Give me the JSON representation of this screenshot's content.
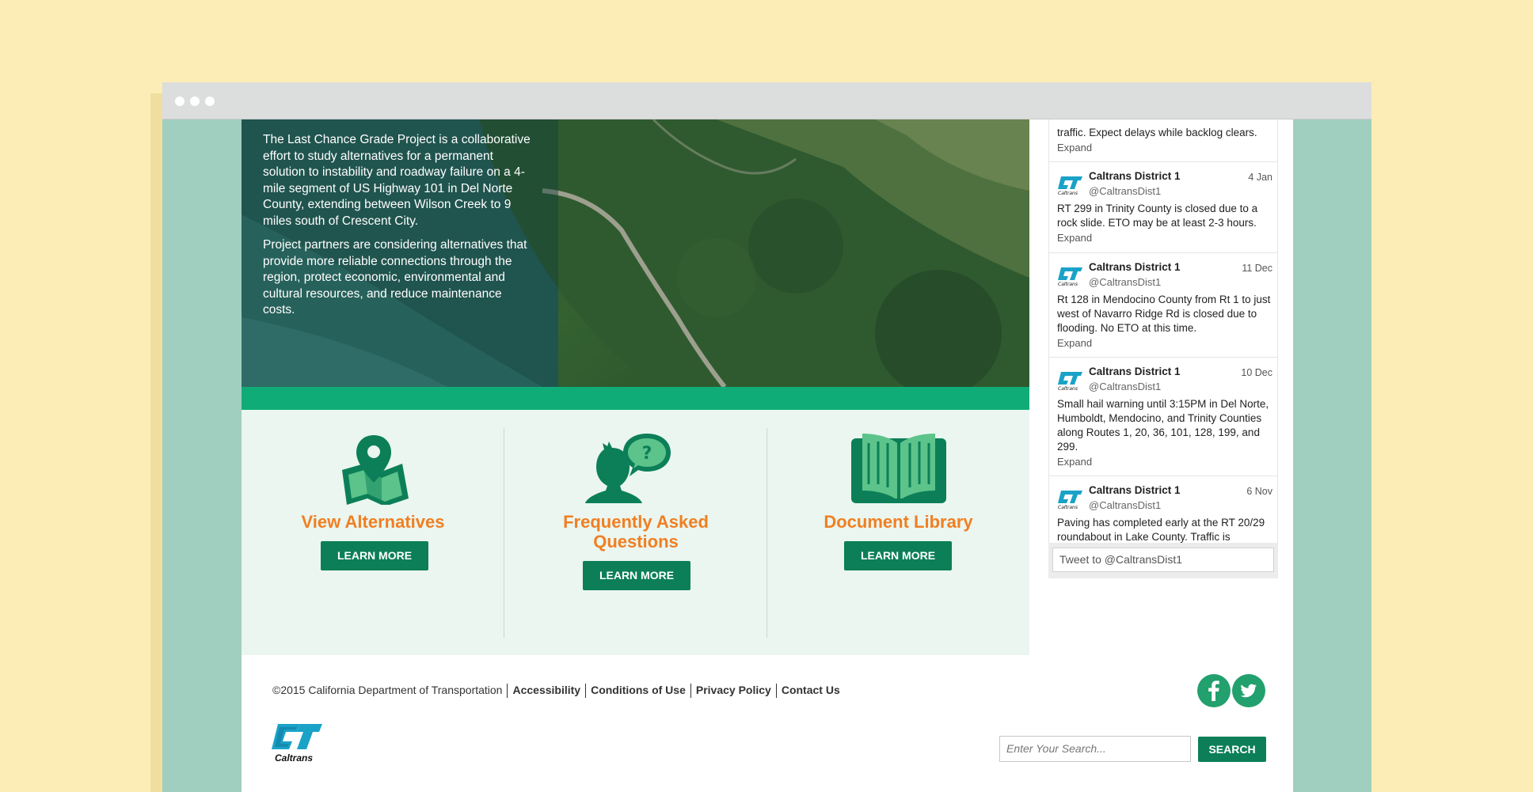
{
  "hero": {
    "paragraph1": "The Last Chance Grade Project is a collaborative effort to study alternatives for a permanent solution to instability and roadway failure on a 4-mile segment of US Highway 101 in Del Norte County, extending between Wilson Creek to 9 miles south of Crescent City.",
    "paragraph2": "Project partners are considering alternatives that provide more reliable connections through the region, protect economic, environmental and cultural resources, and reduce maintenance costs."
  },
  "cards": [
    {
      "title": "View Alternatives",
      "button": "LEARN MORE",
      "icon": "map-pin-icon"
    },
    {
      "title_line1": "Frequently Asked",
      "title_line2": "Questions",
      "button": "LEARN MORE",
      "icon": "person-question-icon"
    },
    {
      "title": "Document Library",
      "button": "LEARN MORE",
      "icon": "open-book-icon"
    }
  ],
  "twitter": {
    "partial": {
      "text": "traffic. Expect delays while backlog clears.",
      "expand": "Expand"
    },
    "tweets": [
      {
        "name": "Caltrans District 1",
        "handle": "@CaltransDist1",
        "date": "4 Jan",
        "text": "RT 299 in Trinity County is closed due to a rock slide. ETO may be at least 2-3 hours.",
        "expand": "Expand"
      },
      {
        "name": "Caltrans District 1",
        "handle": "@CaltransDist1",
        "date": "11 Dec",
        "text": "Rt 128 in Mendocino County from Rt 1 to just west of Navarro Ridge Rd is closed due to flooding.  No ETO at this time.",
        "expand": "Expand"
      },
      {
        "name": "Caltrans District 1",
        "handle": "@CaltransDist1",
        "date": "10 Dec",
        "text": "Small hail warning until 3:15PM in Del Norte, Humboldt, Mendocino, and Trinity Counties along Routes 1, 20, 36, 101, 128, 199, and 299.",
        "expand": "Expand"
      },
      {
        "name": "Caltrans District 1",
        "handle": "@CaltransDist1",
        "date": "6 Nov",
        "text": "Paving has completed early at the RT 20/29 roundabout in Lake County.  Traffic is",
        "expand": ""
      }
    ],
    "tweet_box_placeholder": "Tweet to @CaltransDist1"
  },
  "footer": {
    "copyright": "©2015 California Department of Transportation",
    "links": [
      "Accessibility",
      "Conditions of Use",
      "Privacy Policy",
      "Contact Us"
    ],
    "logo_text": "Caltrans",
    "search_placeholder": "Enter Your Search...",
    "search_button": "SEARCH"
  },
  "colors": {
    "brand_green": "#0c7f58",
    "band_green": "#0fac78",
    "accent_orange": "#f07f23",
    "card_bg": "#eaf6ef",
    "social_green": "#22a06d"
  }
}
